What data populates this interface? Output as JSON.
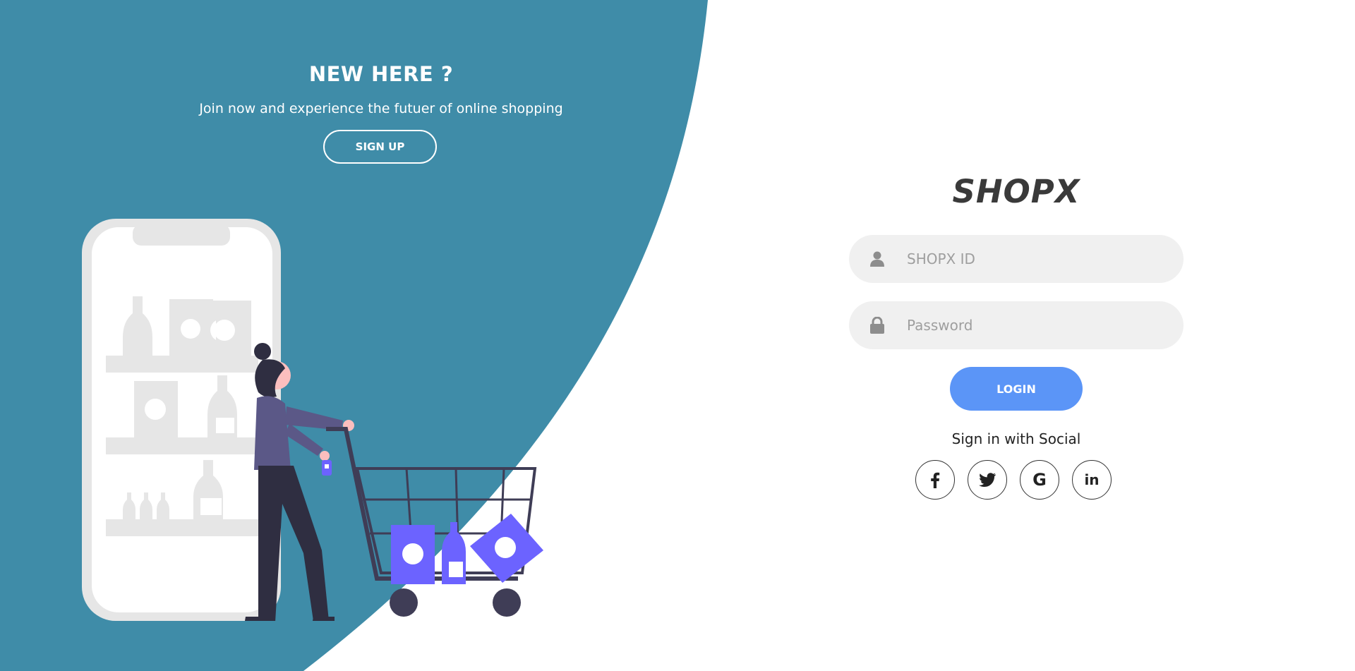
{
  "colors": {
    "panel_bg": "#3f8ca8",
    "accent": "#5b95f7",
    "field_bg": "#f0f0f0",
    "illustration_purple": "#6c63ff",
    "figure_shirt": "#5b5887",
    "figure_pants": "#2f2e41"
  },
  "left_panel": {
    "title": "NEW HERE ?",
    "subtitle": "Join now and experience the futuer of online shopping",
    "signup_label": "SIGN UP"
  },
  "login": {
    "brand": "SHOPX",
    "id_placeholder": "SHOPX ID",
    "password_placeholder": "Password",
    "login_label": "LOGIN",
    "social_text": "Sign in with Social",
    "socials": [
      {
        "name": "facebook",
        "icon": "facebook-icon"
      },
      {
        "name": "twitter",
        "icon": "twitter-icon"
      },
      {
        "name": "google",
        "icon": "google-icon"
      },
      {
        "name": "linkedin",
        "icon": "linkedin-icon"
      }
    ]
  }
}
